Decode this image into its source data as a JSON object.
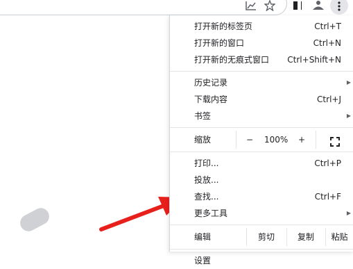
{
  "toolbar": {
    "icons": [
      "trending-chart-icon",
      "bookmark-star-icon",
      "reading-list-icon",
      "profile-icon",
      "more-vert-icon"
    ]
  },
  "menu": {
    "group1": [
      {
        "label": "打开新的标签页",
        "shortcut": "Ctrl+T"
      },
      {
        "label": "打开新的窗口",
        "shortcut": "Ctrl+N"
      },
      {
        "label": "打开新的无痕式窗口",
        "shortcut": "Ctrl+Shift+N"
      }
    ],
    "group2": [
      {
        "label": "历史记录",
        "shortcut": "",
        "submenu": "▶"
      },
      {
        "label": "下载内容",
        "shortcut": "Ctrl+J"
      },
      {
        "label": "书签",
        "shortcut": "",
        "submenu": "▶"
      }
    ],
    "zoom": {
      "label": "缩放",
      "minus": "−",
      "value": "100%",
      "plus": "+"
    },
    "group3": [
      {
        "label": "打印...",
        "shortcut": "Ctrl+P"
      },
      {
        "label": "投放...",
        "shortcut": ""
      },
      {
        "label": "查找...",
        "shortcut": "Ctrl+F"
      },
      {
        "label": "更多工具",
        "shortcut": "",
        "submenu": "▶"
      }
    ],
    "edit": {
      "label": "编辑",
      "cut": "剪切",
      "copy": "复制",
      "paste": "粘贴"
    },
    "settings": {
      "label": "设置"
    }
  },
  "colors": {
    "arrow": "#e8201c",
    "menu_bg": "#ffffff",
    "separator": "#e3e4e6"
  }
}
